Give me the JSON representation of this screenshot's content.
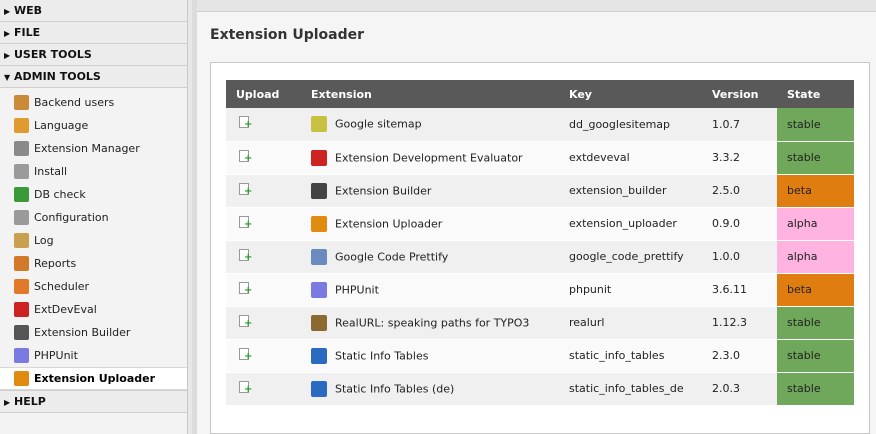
{
  "sidebar": {
    "groups": [
      {
        "label": "WEB",
        "expanded": false
      },
      {
        "label": "FILE",
        "expanded": false
      },
      {
        "label": "USER TOOLS",
        "expanded": false
      },
      {
        "label": "ADMIN TOOLS",
        "expanded": true
      },
      {
        "label": "HELP",
        "expanded": false
      }
    ],
    "admin_items": [
      {
        "label": "Backend users",
        "icon": "users-icon",
        "color": "#c98a3a"
      },
      {
        "label": "Language",
        "icon": "language-flag-icon",
        "color": "#e09a30"
      },
      {
        "label": "Extension Manager",
        "icon": "extension-manager-icon",
        "color": "#8a8a8a"
      },
      {
        "label": "Install",
        "icon": "install-icon",
        "color": "#9a9a9a"
      },
      {
        "label": "DB check",
        "icon": "db-check-icon",
        "color": "#3a9a3a"
      },
      {
        "label": "Configuration",
        "icon": "configuration-icon",
        "color": "#9a9a9a"
      },
      {
        "label": "Log",
        "icon": "log-icon",
        "color": "#c9a050"
      },
      {
        "label": "Reports",
        "icon": "reports-icon",
        "color": "#d07a2a"
      },
      {
        "label": "Scheduler",
        "icon": "scheduler-icon",
        "color": "#e07a2a"
      },
      {
        "label": "ExtDevEval",
        "icon": "extdeveval-icon",
        "color": "#cc2222"
      },
      {
        "label": "Extension Builder",
        "icon": "extension-builder-icon",
        "color": "#555555"
      },
      {
        "label": "PHPUnit",
        "icon": "phpunit-icon",
        "color": "#7a7ae0"
      },
      {
        "label": "Extension Uploader",
        "icon": "extension-uploader-icon",
        "color": "#e08a10",
        "active": true
      }
    ]
  },
  "main": {
    "title": "Extension Uploader",
    "table": {
      "headers": [
        "Upload",
        "Extension",
        "Key",
        "Version",
        "State"
      ],
      "rows": [
        {
          "extension": "Google sitemap",
          "key": "dd_googlesitemap",
          "version": "1.0.7",
          "state": "stable",
          "icon": "google-sitemap-icon",
          "icon_color": "#c8c040"
        },
        {
          "extension": "Extension Development Evaluator",
          "key": "extdeveval",
          "version": "3.3.2",
          "state": "stable",
          "icon": "extdeveval-icon",
          "icon_color": "#cc2222"
        },
        {
          "extension": "Extension Builder",
          "key": "extension_builder",
          "version": "2.5.0",
          "state": "beta",
          "icon": "typo3-icon",
          "icon_color": "#444444"
        },
        {
          "extension": "Extension Uploader",
          "key": "extension_uploader",
          "version": "0.9.0",
          "state": "alpha",
          "icon": "extension-uploader-icon",
          "icon_color": "#e08a10"
        },
        {
          "extension": "Google Code Prettify",
          "key": "google_code_prettify",
          "version": "1.0.0",
          "state": "alpha",
          "icon": "google-code-prettify-icon",
          "icon_color": "#6a8ac0"
        },
        {
          "extension": "PHPUnit",
          "key": "phpunit",
          "version": "3.6.11",
          "state": "beta",
          "icon": "phpunit-icon",
          "icon_color": "#7a7ae0"
        },
        {
          "extension": "RealURL: speaking paths for TYPO3",
          "key": "realurl",
          "version": "1.12.3",
          "state": "stable",
          "icon": "realurl-icon",
          "icon_color": "#8a6a30"
        },
        {
          "extension": "Static Info Tables",
          "key": "static_info_tables",
          "version": "2.3.0",
          "state": "stable",
          "icon": "globe-icon",
          "icon_color": "#2a6ac0"
        },
        {
          "extension": "Static Info Tables (de)",
          "key": "static_info_tables_de",
          "version": "2.0.3",
          "state": "stable",
          "icon": "globe-icon",
          "icon_color": "#2a6ac0"
        }
      ]
    }
  },
  "colors": {
    "stable": "#6fa85a",
    "beta": "#e07d10",
    "alpha": "#ffb3e0"
  }
}
